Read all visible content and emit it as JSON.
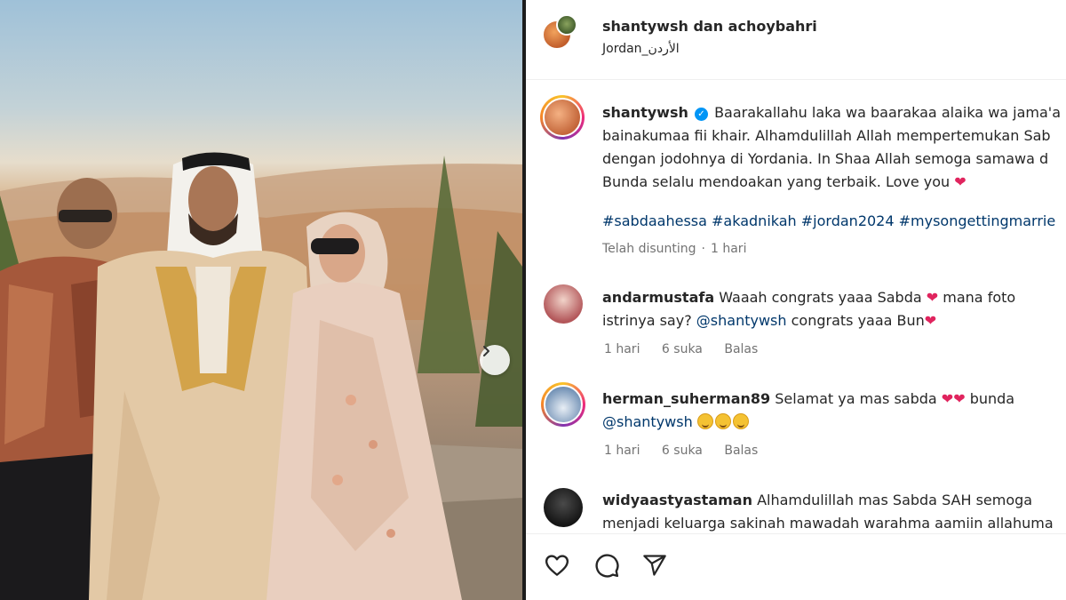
{
  "post": {
    "header": {
      "title": "shantywsh dan achoybahri",
      "location": "Jordan_الأردن"
    },
    "caption": {
      "username": "shantywsh",
      "line1": "Baarakallahu laka wa baarakaa alaika wa jama'a",
      "line2": "bainakumaa fii khair. Alhamdulillah Allah mempertemukan Sab",
      "line3": "dengan jodohnya di Yordania. In Shaa Allah semoga samawa d",
      "line4": "Bunda selalu mendoakan yang terbaik. Love you",
      "hashtags": "#sabdaahessa #akadnikah #jordan2024 #mysongettingmarrie",
      "edited": "Telah disunting",
      "time": "1 hari"
    },
    "comments": [
      {
        "username": "andarmustafa",
        "line1": "Waaah congrats yaaa Sabda",
        "line1b": "mana foto",
        "line2a": "istrinya say?",
        "mention": "@shantywsh",
        "line2b": "congrats yaaa Bun",
        "time": "1 hari",
        "likes": "6 suka",
        "reply": "Balas"
      },
      {
        "username": "herman_suherman89",
        "line1": "Selamat ya mas sabda",
        "line1b": "bunda",
        "mention": "@shantywsh",
        "time": "1 hari",
        "likes": "6 suka",
        "reply": "Balas"
      },
      {
        "username": "widyaastyastaman",
        "line1": "Alhamdulillah mas Sabda SAH semoga",
        "line2": "menjadi keluarga sakinah mawadah warahma aamiin allahuma"
      }
    ],
    "heart_glyph": "❤",
    "actions": [
      "heart-icon",
      "comment-icon",
      "share-icon"
    ],
    "colors": {
      "link": "#00376b",
      "heart": "#e0245e",
      "verified": "#0095f6",
      "muted": "#737373"
    }
  }
}
